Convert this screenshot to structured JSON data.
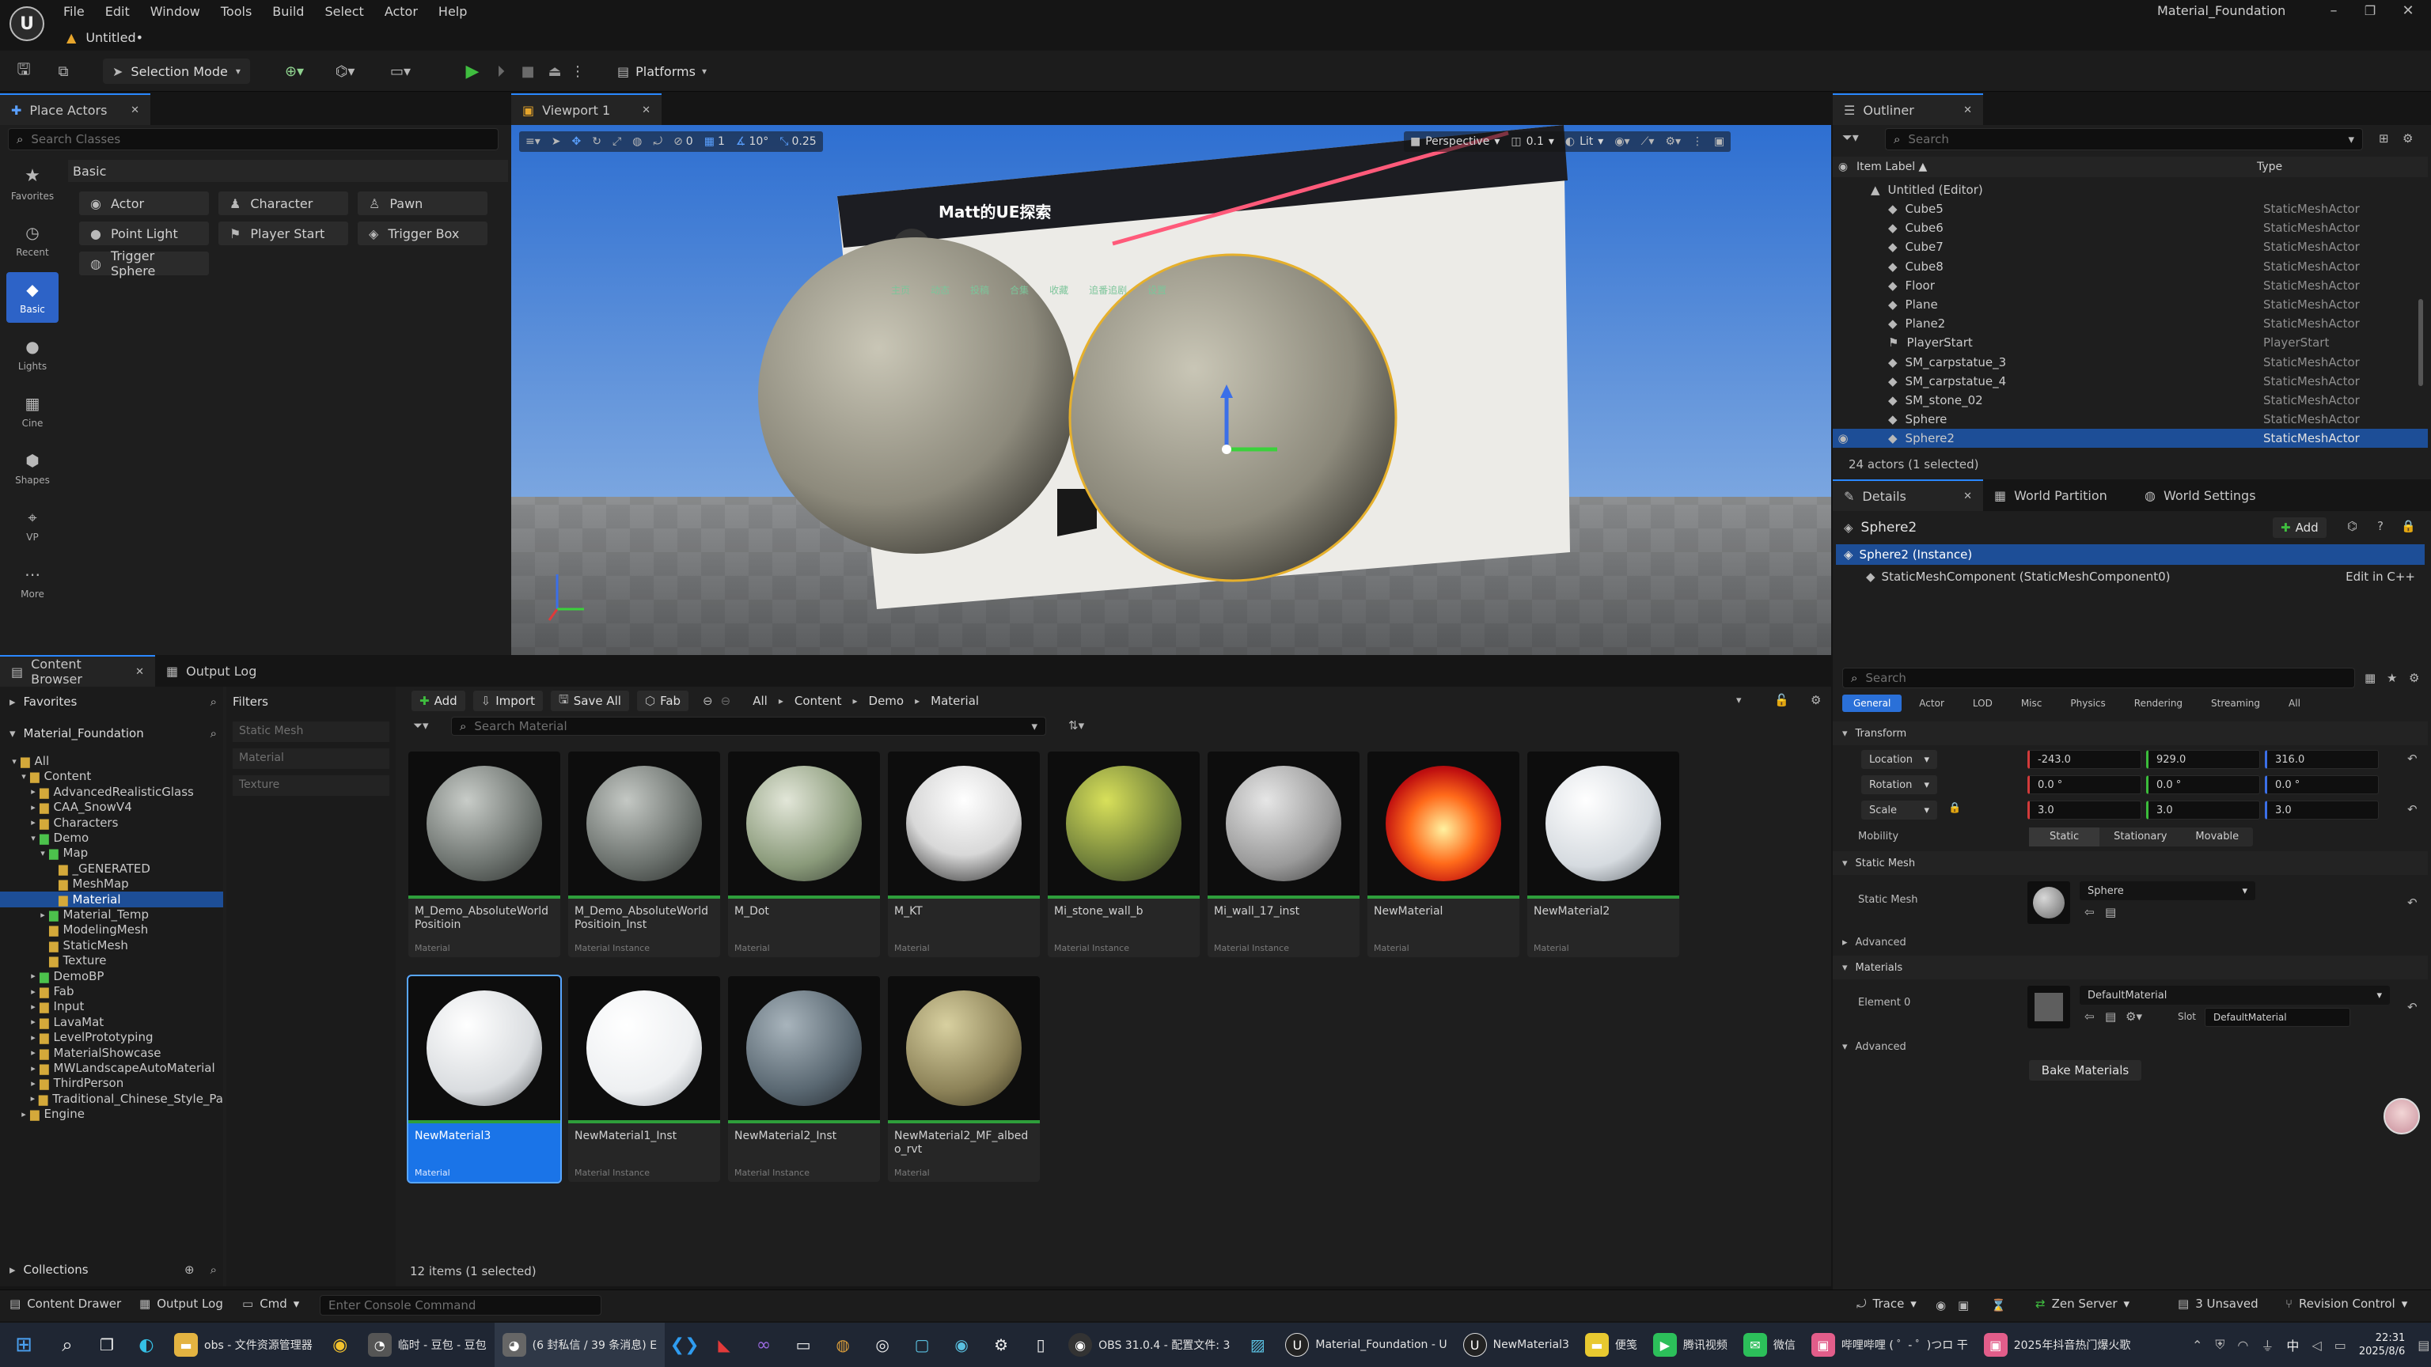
{
  "app": {
    "tab_title": "Untitled•",
    "project_name": "Material_Foundation",
    "menu": [
      "File",
      "Edit",
      "Window",
      "Tools",
      "Build",
      "Select",
      "Actor",
      "Help"
    ]
  },
  "toolbar": {
    "selection_mode": "Selection Mode",
    "platforms": "Platforms"
  },
  "place_actors": {
    "tab_label": "Place Actors",
    "search_placeholder": "Search Classes",
    "category_header": "Basic",
    "sidebar": [
      "Favorites",
      "Recent",
      "Basic",
      "Lights",
      "Cine",
      "Shapes",
      "VP",
      "More"
    ],
    "actors": [
      "Actor",
      "Character",
      "Pawn",
      "Point Light",
      "Player Start",
      "Trigger Box",
      "Trigger Sphere"
    ]
  },
  "viewport": {
    "tab_label": "Viewport 1",
    "grid_snap": "10",
    "rot_snap": "10°",
    "scale_snap": "0.25",
    "translate_count": "0",
    "camera_count": "1",
    "perspective": "Perspective",
    "camera_speed": "0.1",
    "lit": "Lit",
    "billboard_title": "Matt的UE探索",
    "billboard_nav": [
      "主页",
      "动态",
      "投稿",
      "合集",
      "收藏",
      "追番追剧",
      "设置"
    ]
  },
  "outliner": {
    "tab_label": "Outliner",
    "search_placeholder": "Search",
    "col_label": "Item Label ▲",
    "col_type": "Type",
    "root": "Untitled (Editor)",
    "items": [
      {
        "label": "Cube5",
        "type": "StaticMeshActor"
      },
      {
        "label": "Cube6",
        "type": "StaticMeshActor"
      },
      {
        "label": "Cube7",
        "type": "StaticMeshActor"
      },
      {
        "label": "Cube8",
        "type": "StaticMeshActor"
      },
      {
        "label": "Floor",
        "type": "StaticMeshActor"
      },
      {
        "label": "Plane",
        "type": "StaticMeshActor"
      },
      {
        "label": "Plane2",
        "type": "StaticMeshActor"
      },
      {
        "label": "PlayerStart",
        "type": "PlayerStart"
      },
      {
        "label": "SM_carpstatue_3",
        "type": "StaticMeshActor"
      },
      {
        "label": "SM_carpstatue_4",
        "type": "StaticMeshActor"
      },
      {
        "label": "SM_stone_02",
        "type": "StaticMeshActor"
      },
      {
        "label": "Sphere",
        "type": "StaticMeshActor"
      },
      {
        "label": "Sphere2",
        "type": "StaticMeshActor"
      }
    ],
    "count": "24 actors (1 selected)"
  },
  "details": {
    "tabs": [
      "Details",
      "World Partition",
      "World Settings"
    ],
    "object_name": "Sphere2",
    "add_label": "Add",
    "instance": "Sphere2 (Instance)",
    "component": "StaticMeshComponent (StaticMeshComponent0)",
    "edit_cpp": "Edit in C++",
    "search_placeholder": "Search",
    "categories": [
      "General",
      "Actor",
      "LOD",
      "Misc",
      "Physics",
      "Rendering",
      "Streaming",
      "All"
    ],
    "transform_header": "Transform",
    "location_label": "Location",
    "location": [
      "-243.0",
      "929.0",
      "316.0"
    ],
    "rotation_label": "Rotation",
    "rotation": [
      "0.0 °",
      "0.0 °",
      "0.0 °"
    ],
    "scale_label": "Scale",
    "scale": [
      "3.0",
      "3.0",
      "3.0"
    ],
    "mobility_label": "Mobility",
    "mobility": [
      "Static",
      "Stationary",
      "Movable"
    ],
    "static_mesh_header": "Static Mesh",
    "static_mesh_label": "Static Mesh",
    "static_mesh_value": "Sphere",
    "advanced": "Advanced",
    "materials_header": "Materials",
    "element0_label": "Element 0",
    "element0_value": "DefaultMaterial",
    "slot_label": "Slot",
    "slot_value": "DefaultMaterial",
    "bake_button": "Bake Materials"
  },
  "content_browser": {
    "tabs": [
      "Content Browser",
      "Output Log"
    ],
    "favorites": "Favorites",
    "project": "Material_Foundation",
    "filters": "Filters",
    "filter_items": [
      "Static Mesh",
      "Material",
      "Texture"
    ],
    "add": "Add",
    "import": "Import",
    "save_all": "Save All",
    "fab": "Fab",
    "breadcrumb": [
      "All",
      "Content",
      "Demo",
      "Material"
    ],
    "search_placeholder": "Search Material",
    "tree": [
      "All",
      "Content",
      "AdvancedRealisticGlass",
      "CAA_SnowV4",
      "Characters",
      "Demo",
      "Map",
      "_GENERATED",
      "MeshMap",
      "Material",
      "Material_Temp",
      "ModelingMesh",
      "StaticMesh",
      "Texture",
      "DemoBP",
      "Fab",
      "Input",
      "LavaMat",
      "LevelPrototyping",
      "MaterialShowcase",
      "MWLandscapeAutoMaterial",
      "ThirdPerson",
      "Traditional_Chinese_Style_Pa",
      "Engine"
    ],
    "collections": "Collections",
    "status": "12 items (1 selected)",
    "assets": [
      {
        "name": "M_Demo_AbsoluteWorldPositioin",
        "type": "Material"
      },
      {
        "name": "M_Demo_AbsoluteWorldPositioin_Inst",
        "type": "Material Instance"
      },
      {
        "name": "M_Dot",
        "type": "Material"
      },
      {
        "name": "M_KT",
        "type": "Material"
      },
      {
        "name": "Mi_stone_wall_b",
        "type": "Material Instance"
      },
      {
        "name": "Mi_wall_17_inst",
        "type": "Material Instance"
      },
      {
        "name": "NewMaterial",
        "type": "Material"
      },
      {
        "name": "NewMaterial2",
        "type": "Material"
      },
      {
        "name": "NewMaterial3",
        "type": "Material"
      },
      {
        "name": "NewMaterial1_Inst",
        "type": "Material Instance"
      },
      {
        "name": "NewMaterial2_Inst",
        "type": "Material Instance"
      },
      {
        "name": "NewMaterial2_MF_albedo_rvt",
        "type": "Material"
      }
    ]
  },
  "statusbar": {
    "content_drawer": "Content Drawer",
    "output_log": "Output Log",
    "cmd": "Cmd",
    "console_placeholder": "Enter Console Command",
    "trace": "Trace",
    "zen_server": "Zen Server",
    "unsaved": "3 Unsaved",
    "revision": "Revision Control"
  },
  "taskbar": {
    "items": [
      "obs - 文件资源管理器",
      "临时 - 豆包 - 豆包",
      "(6 封私信 / 39 条消息) E",
      "OBS 31.0.4 - 配置文件: 3",
      "Material_Foundation - U",
      "NewMaterial3",
      "便笺",
      "腾讯视频",
      "微信",
      "哔哩哔哩 ( ゜- ゜)つロ 干",
      "2025年抖音热门爆火歌"
    ],
    "time": "22:31",
    "date": "2025/8/6",
    "lang": "中"
  },
  "colors": {
    "accent": "#2a70d8",
    "selected_row": "#1d4e97",
    "green_play": "#3fbd3f",
    "asset_bar": "#2e9e3b"
  }
}
